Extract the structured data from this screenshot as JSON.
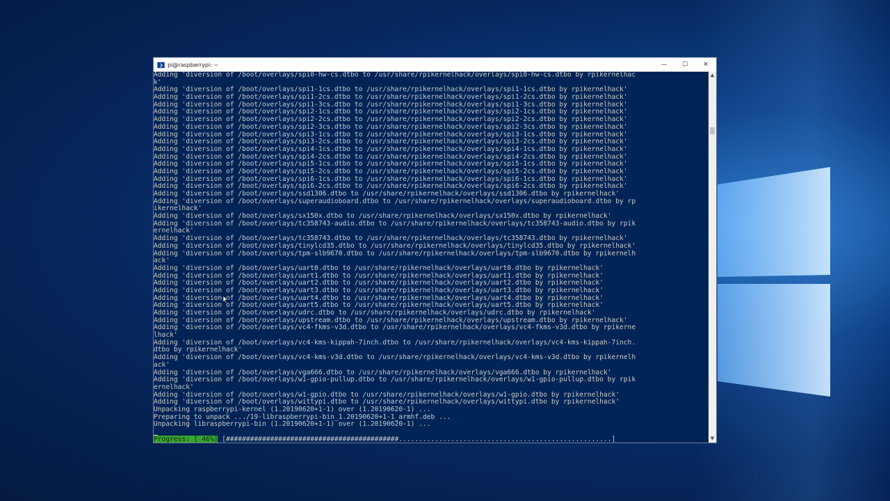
{
  "window": {
    "title": "pi@raspberrypi: ~",
    "controls": {
      "minimize": "—",
      "maximize": "☐",
      "close": "✕"
    }
  },
  "terminal": {
    "lines": [
      "Adding 'diversion of /boot/overlays/spi0-hw-cs.dtbo to /usr/share/rpikernelhack/overlays/spi0-hw-cs.dtbo by rpikernelhac",
      "k'",
      "Adding 'diversion of /boot/overlays/spi1-1cs.dtbo to /usr/share/rpikernelhack/overlays/spi1-1cs.dtbo by rpikernelhack'",
      "Adding 'diversion of /boot/overlays/spi1-2cs.dtbo to /usr/share/rpikernelhack/overlays/spi1-2cs.dtbo by rpikernelhack'",
      "Adding 'diversion of /boot/overlays/spi1-3cs.dtbo to /usr/share/rpikernelhack/overlays/spi1-3cs.dtbo by rpikernelhack'",
      "Adding 'diversion of /boot/overlays/spi2-1cs.dtbo to /usr/share/rpikernelhack/overlays/spi2-1cs.dtbo by rpikernelhack'",
      "Adding 'diversion of /boot/overlays/spi2-2cs.dtbo to /usr/share/rpikernelhack/overlays/spi2-2cs.dtbo by rpikernelhack'",
      "Adding 'diversion of /boot/overlays/spi2-3cs.dtbo to /usr/share/rpikernelhack/overlays/spi2-3cs.dtbo by rpikernelhack'",
      "Adding 'diversion of /boot/overlays/spi3-1cs.dtbo to /usr/share/rpikernelhack/overlays/spi3-1cs.dtbo by rpikernelhack'",
      "Adding 'diversion of /boot/overlays/spi3-2cs.dtbo to /usr/share/rpikernelhack/overlays/spi3-2cs.dtbo by rpikernelhack'",
      "Adding 'diversion of /boot/overlays/spi4-1cs.dtbo to /usr/share/rpikernelhack/overlays/spi4-1cs.dtbo by rpikernelhack'",
      "Adding 'diversion of /boot/overlays/spi4-2cs.dtbo to /usr/share/rpikernelhack/overlays/spi4-2cs.dtbo by rpikernelhack'",
      "Adding 'diversion of /boot/overlays/spi5-1cs.dtbo to /usr/share/rpikernelhack/overlays/spi5-1cs.dtbo by rpikernelhack'",
      "Adding 'diversion of /boot/overlays/spi5-2cs.dtbo to /usr/share/rpikernelhack/overlays/spi5-2cs.dtbo by rpikernelhack'",
      "Adding 'diversion of /boot/overlays/spi6-1cs.dtbo to /usr/share/rpikernelhack/overlays/spi6-1cs.dtbo by rpikernelhack'",
      "Adding 'diversion of /boot/overlays/spi6-2cs.dtbo to /usr/share/rpikernelhack/overlays/spi6-2cs.dtbo by rpikernelhack'",
      "Adding 'diversion of /boot/overlays/ssd1306.dtbo to /usr/share/rpikernelhack/overlays/ssd1306.dtbo by rpikernelhack'",
      "Adding 'diversion of /boot/overlays/superaudioboard.dtbo to /usr/share/rpikernelhack/overlays/superaudioboard.dtbo by rp",
      "ikernelhack'",
      "Adding 'diversion of /boot/overlays/sx150x.dtbo to /usr/share/rpikernelhack/overlays/sx150x.dtbo by rpikernelhack'",
      "Adding 'diversion of /boot/overlays/tc358743-audio.dtbo to /usr/share/rpikernelhack/overlays/tc358743-audio.dtbo by rpik",
      "ernelhack'",
      "Adding 'diversion of /boot/overlays/tc358743.dtbo to /usr/share/rpikernelhack/overlays/tc358743.dtbo by rpikernelhack'",
      "Adding 'diversion of /boot/overlays/tinylcd35.dtbo to /usr/share/rpikernelhack/overlays/tinylcd35.dtbo by rpikernelhack'",
      "Adding 'diversion of /boot/overlays/tpm-slb9670.dtbo to /usr/share/rpikernelhack/overlays/tpm-slb9670.dtbo by rpikernelh",
      "ack'",
      "Adding 'diversion of /boot/overlays/uart0.dtbo to /usr/share/rpikernelhack/overlays/uart0.dtbo by rpikernelhack'",
      "Adding 'diversion of /boot/overlays/uart1.dtbo to /usr/share/rpikernelhack/overlays/uart1.dtbo by rpikernelhack'",
      "Adding 'diversion of /boot/overlays/uart2.dtbo to /usr/share/rpikernelhack/overlays/uart2.dtbo by rpikernelhack'",
      "Adding 'diversion of /boot/overlays/uart3.dtbo to /usr/share/rpikernelhack/overlays/uart3.dtbo by rpikernelhack'",
      "Adding 'diversion of /boot/overlays/uart4.dtbo to /usr/share/rpikernelhack/overlays/uart4.dtbo by rpikernelhack'",
      "Adding 'diversion of /boot/overlays/uart5.dtbo to /usr/share/rpikernelhack/overlays/uart5.dtbo by rpikernelhack'",
      "Adding 'diversion of /boot/overlays/udrc.dtbo to /usr/share/rpikernelhack/overlays/udrc.dtbo by rpikernelhack'",
      "Adding 'diversion of /boot/overlays/upstream.dtbo to /usr/share/rpikernelhack/overlays/upstream.dtbo by rpikernelhack'",
      "Adding 'diversion of /boot/overlays/vc4-fkms-v3d.dtbo to /usr/share/rpikernelhack/overlays/vc4-fkms-v3d.dtbo by rpikerne",
      "lhack'",
      "Adding 'diversion of /boot/overlays/vc4-kms-kippah-7inch.dtbo to /usr/share/rpikernelhack/overlays/vc4-kms-kippah-7inch.",
      "dtbo by rpikernelhack'",
      "Adding 'diversion of /boot/overlays/vc4-kms-v3d.dtbo to /usr/share/rpikernelhack/overlays/vc4-kms-v3d.dtbo by rpikernelh",
      "ack'",
      "Adding 'diversion of /boot/overlays/vga666.dtbo to /usr/share/rpikernelhack/overlays/vga666.dtbo by rpikernelhack'",
      "Adding 'diversion of /boot/overlays/w1-gpio-pullup.dtbo to /usr/share/rpikernelhack/overlays/w1-gpio-pullup.dtbo by rpik",
      "ernelhack'",
      "Adding 'diversion of /boot/overlays/w1-gpio.dtbo to /usr/share/rpikernelhack/overlays/w1-gpio.dtbo by rpikernelhack'",
      "Adding 'diversion of /boot/overlays/wittypi.dtbo to /usr/share/rpikernelhack/overlays/wittypi.dtbo by rpikernelhack'",
      "Unpacking raspberrypi-kernel (1.20190620+1-1) over (1.20190620-1) ...",
      "Preparing to unpack .../19-libraspberrypi-bin_1.20190620+1-1_armhf.deb ...",
      "Unpacking libraspberrypi-bin (1.20190620+1-1) over (1.20190620-1) ...",
      ""
    ],
    "progress": {
      "label": "Progress: [ 46%]",
      "bar": " [###########################################.....................................................]",
      "percent": 46
    }
  },
  "colors": {
    "terminal_bg": "#012456",
    "terminal_fg": "#cccccc",
    "progress_label_bg": "#37a52f"
  }
}
